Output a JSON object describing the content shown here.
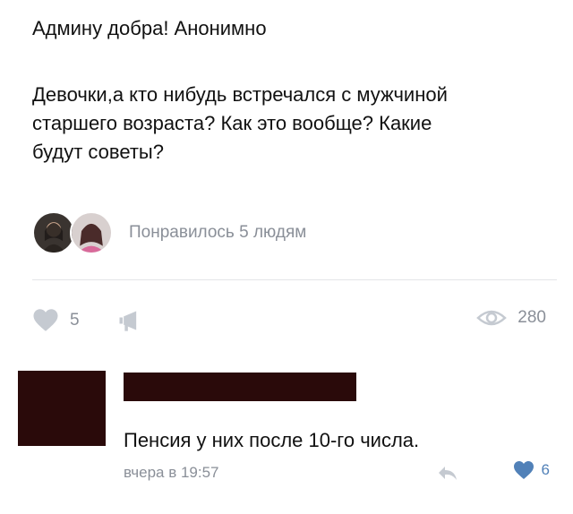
{
  "post": {
    "header": "Админу добра! Анонимно",
    "body_lines": [
      "Девочки,а кто нибудь встречался с мужчиной",
      "старшего возраста? Как это вообще? Какие",
      "будут советы?"
    ],
    "likers_text": "Понравилось 5 людям",
    "likes": "5",
    "views": "280"
  },
  "comment": {
    "text": "Пенсия у них после 10-го числа.",
    "time": "вчера в 19:57",
    "likes": "6"
  },
  "icons": {
    "like": "heart-icon",
    "share": "megaphone-icon",
    "views": "eye-icon",
    "reply": "reply-arrow-icon",
    "comment_like": "heart-icon"
  },
  "colors": {
    "text": "#111111",
    "muted": "#8a8f98",
    "icon_muted": "#c5cad1",
    "accent": "#5181b8",
    "redaction": "#2a0a0a"
  }
}
